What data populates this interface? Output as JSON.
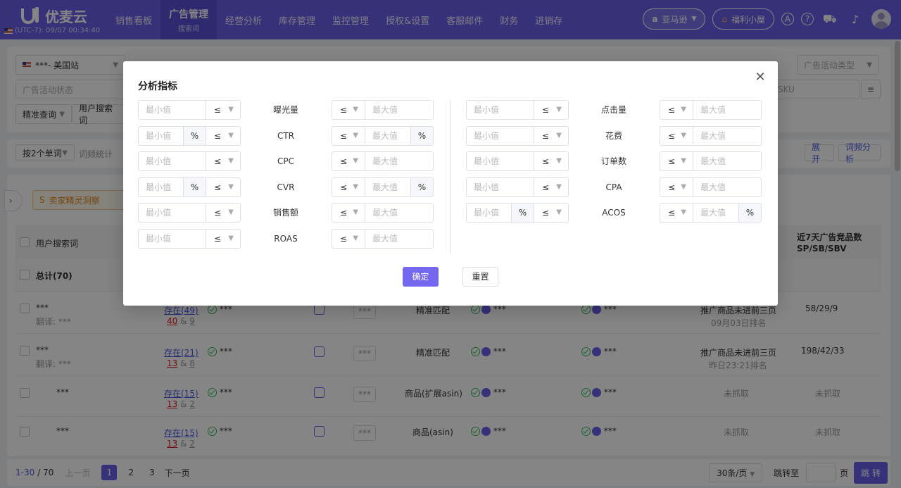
{
  "header": {
    "brand": "优麦云",
    "timezone": "(UTC-7): 09/07 00:34:40",
    "nav": [
      {
        "label": "销售看板"
      },
      {
        "label": "广告管理",
        "sub": "搜索词"
      },
      {
        "label": "经营分析"
      },
      {
        "label": "库存管理"
      },
      {
        "label": "监控管理"
      },
      {
        "label": "授权&设置"
      },
      {
        "label": "客服邮件"
      },
      {
        "label": "财务"
      },
      {
        "label": "进销存"
      }
    ],
    "platform": "亚马逊",
    "welfare": "福利小屋"
  },
  "filters": {
    "store": "***- 美国站",
    "campaign_type_placeholder": "广告活动类型",
    "campaign_status_placeholder": "广告活动状态",
    "sku_placeholder": "SKU",
    "match_query": "精准查询",
    "search_term_select": "用户搜索词"
  },
  "toolbar": {
    "split": "按2个单词",
    "word_stats": "词频统计",
    "expand": "展 开",
    "word_analysis": "词频分析"
  },
  "banner": {
    "label": "卖家精灵洞察"
  },
  "table": {
    "col_search_term": "用户搜索词",
    "col_competitors_line1": "近7天广告竞品数",
    "col_competitors_line2": "SP/SB/SBV",
    "total": "总计(70)",
    "rows": [
      {
        "term": "***",
        "sub": "翻译: ***",
        "stock": "存在(49)",
        "n1": "40",
        "n2": "9",
        "masked": "***",
        "match": "精准匹配",
        "rank": "推广商品未进前三页",
        "rank_time": "09月03日排名",
        "competitors": "58/29/9"
      },
      {
        "term": "***",
        "sub": "翻译: ***",
        "stock": "存在(21)",
        "n1": "13",
        "n2": "8",
        "masked": "***",
        "match": "精准匹配",
        "rank": "推广商品未进前三页",
        "rank_time": "昨日23:21排名",
        "competitors": "198/42/33"
      },
      {
        "term": "***",
        "sub": "",
        "stock": "存在(15)",
        "n1": "13",
        "n2": "2",
        "masked": "***",
        "match": "商品(扩展asin)",
        "rank": "未抓取",
        "rank_time": "",
        "competitors": "未抓取"
      },
      {
        "term": "***",
        "sub": "",
        "stock": "存在(15)",
        "n1": "13",
        "n2": "2",
        "masked": "***",
        "match": "商品(asin)",
        "rank": "未抓取",
        "rank_time": "",
        "competitors": "未抓取"
      }
    ]
  },
  "pagination": {
    "range": "1-30",
    "total": "/ 70",
    "prev": "上一页",
    "pages": [
      "1",
      "2",
      "3"
    ],
    "next": "下一页",
    "page_size": "30条/页",
    "jump_to": "跳转至",
    "page_unit": "页",
    "jump_btn": "跳 转"
  },
  "modal": {
    "title": "分析指标",
    "min_placeholder": "最小值",
    "max_placeholder": "最大值",
    "operator": "≤",
    "percent": "%",
    "left_metrics": [
      "曝光量",
      "CTR",
      "CPC",
      "CVR",
      "销售额",
      "ROAS"
    ],
    "right_metrics": [
      "点击量",
      "花费",
      "订单数",
      "CPA",
      "ACOS"
    ],
    "confirm": "确定",
    "reset": "重置"
  },
  "colors": {
    "brand": "#6a5fe8",
    "primary_button": "#7467f0",
    "success": "#2ebd59",
    "danger": "#e02020"
  }
}
